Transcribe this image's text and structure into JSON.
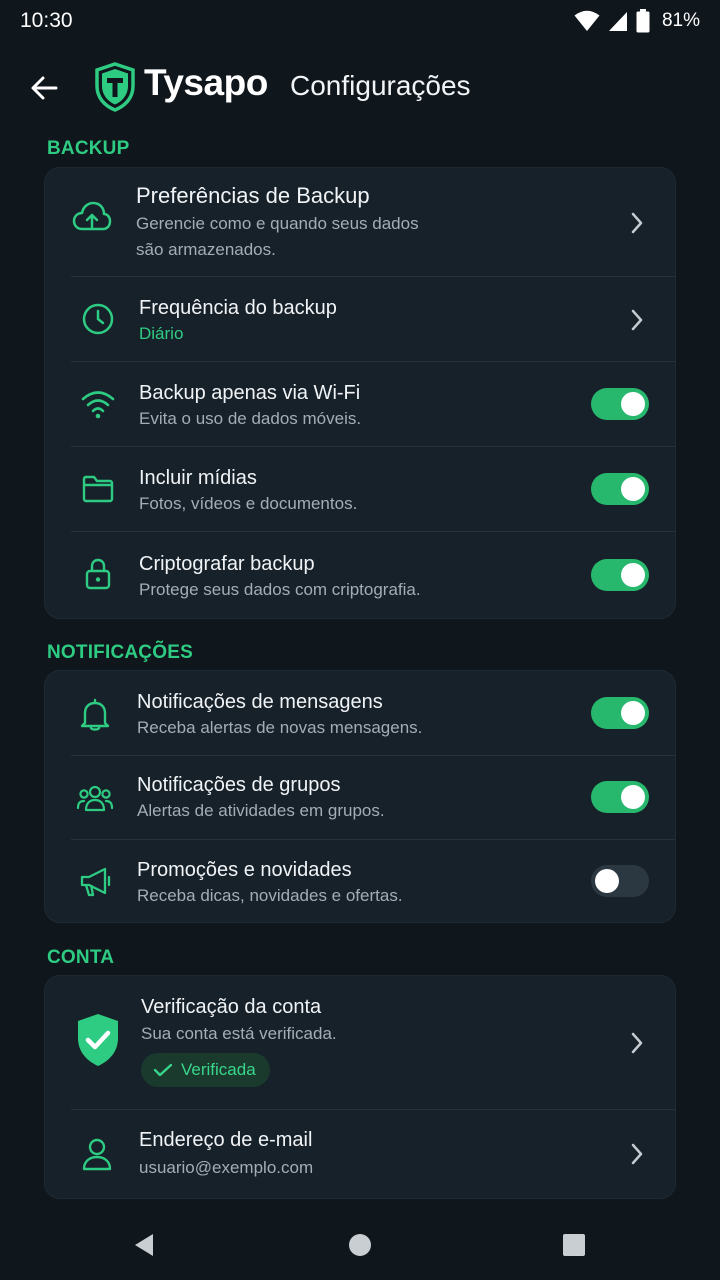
{
  "status_bar": {
    "time": "10:30",
    "battery": "81%"
  },
  "header": {
    "brand": "Tysapo",
    "title": "Configurações"
  },
  "backup": {
    "section_title": "BACKUP",
    "preferences": {
      "title": "Preferências de Backup",
      "subtitle_line1": "Gerencie como e quando seus dados",
      "subtitle_line2": "são armazenados."
    },
    "frequency": {
      "title": "Frequência do backup",
      "value": "Diário"
    },
    "wifi_only": {
      "title": "Backup apenas via Wi-Fi",
      "subtitle": "Evita o uso de dados móveis.",
      "enabled": true
    },
    "include_media": {
      "title": "Incluir mídias",
      "subtitle": "Fotos, vídeos e documentos.",
      "enabled": true
    },
    "encrypt": {
      "title": "Criptografar backup",
      "subtitle": "Protege seus dados com criptografia.",
      "enabled": true
    }
  },
  "notifications": {
    "section_title": "NOTIFICAÇÕES",
    "messages": {
      "title": "Notificações de mensagens",
      "subtitle": "Receba alertas de novas mensagens.",
      "enabled": true
    },
    "groups": {
      "title": "Notificações de grupos",
      "subtitle": "Alertas de atividades em grupos.",
      "enabled": true
    },
    "promotions": {
      "title": "Promoções e novidades",
      "subtitle": "Receba dicas, novidades e ofertas.",
      "enabled": false
    }
  },
  "account": {
    "section_title": "CONTA",
    "verification": {
      "title": "Verificação da conta",
      "subtitle": "Sua conta está verificada.",
      "badge": "Verificada"
    },
    "email": {
      "title": "Endereço de e-mail",
      "value": "usuario@exemplo.com"
    }
  },
  "colors": {
    "accent": "#2ecc82",
    "background": "#0f161c",
    "card": "#17212a",
    "toggle_on": "#27b86e",
    "toggle_off": "#2c3841"
  },
  "icons": [
    "back-arrow-icon",
    "shield-logo-icon",
    "cloud-upload-icon",
    "clock-icon",
    "wifi-icon",
    "folder-icon",
    "lock-icon",
    "bell-icon",
    "group-icon",
    "megaphone-icon",
    "shield-check-icon",
    "user-icon",
    "chevron-right-icon"
  ]
}
